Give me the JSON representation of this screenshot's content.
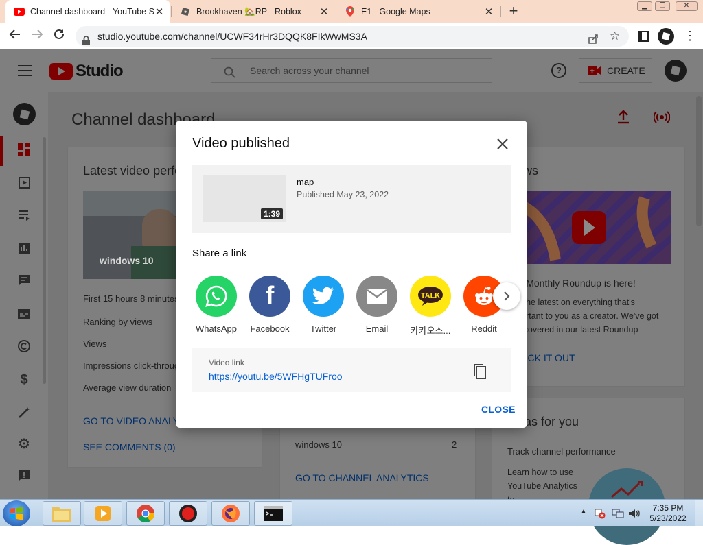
{
  "browser": {
    "tabs": [
      {
        "title": "Channel dashboard - YouTube Studio",
        "icon": "youtube-icon"
      },
      {
        "title": "Brookhaven 🏡RP - Roblox",
        "icon": "roblox-icon"
      },
      {
        "title": "E1 - Google Maps",
        "icon": "google-maps-icon"
      }
    ],
    "new_tab": "+",
    "url": "studio.youtube.com/channel/UCWF34rHr3DQQK8FIkWwMS3A"
  },
  "studio": {
    "logo_text": "Studio",
    "search_placeholder": "Search across your channel",
    "create_label": "CREATE",
    "page_title": "Channel dashboard",
    "latest_video": {
      "title": "Latest video performance",
      "thumb_caption": "windows 10",
      "first_hours": "First 15 hours 8 minutes",
      "rows": [
        "Ranking by views",
        "Views",
        "Impressions click-through rate",
        "Average view duration"
      ],
      "link_analytics": "GO TO VIDEO ANALYTICS",
      "link_comments": "SEE COMMENTS (0)"
    },
    "middle_card": {
      "row_label": "windows 10",
      "row_value": "2",
      "link": "GO TO CHANNEL ANALYTICS"
    },
    "news": {
      "title": "News",
      "headline": "Our Monthly Roundup is here!",
      "body": "Get the latest on everything that's important to you as a creator. We've got you covered in our latest Roundup",
      "link": "CHECK IT OUT"
    },
    "ideas": {
      "title": "Ideas for you",
      "item_title": "Track channel performance",
      "item_body": "Learn how to use YouTube Analytics to"
    }
  },
  "modal": {
    "title": "Video published",
    "video_title": "map",
    "published": "Published May 23, 2022",
    "duration": "1:39",
    "share_heading": "Share a link",
    "share_targets": [
      {
        "label": "WhatsApp",
        "color": "#25d366",
        "icon": "whatsapp-icon"
      },
      {
        "label": "Facebook",
        "color": "#3b5998",
        "icon": "facebook-icon"
      },
      {
        "label": "Twitter",
        "color": "#1da1f2",
        "icon": "twitter-icon"
      },
      {
        "label": "Email",
        "color": "#888888",
        "icon": "email-icon"
      },
      {
        "label": "카카오스...",
        "color": "#ffe812",
        "icon": "kakaotalk-icon"
      },
      {
        "label": "Reddit",
        "color": "#ff4500",
        "icon": "reddit-icon"
      }
    ],
    "link_label": "Video link",
    "link_url": "https://youtu.be/5WFHgTUFroo",
    "close_label": "CLOSE"
  },
  "taskbar": {
    "time": "7:35 PM",
    "date": "5/23/2022"
  },
  "colors": {
    "youtube_red": "#ff0000",
    "link_blue": "#065fd4",
    "overlay_gray": "#7f7f7f"
  }
}
